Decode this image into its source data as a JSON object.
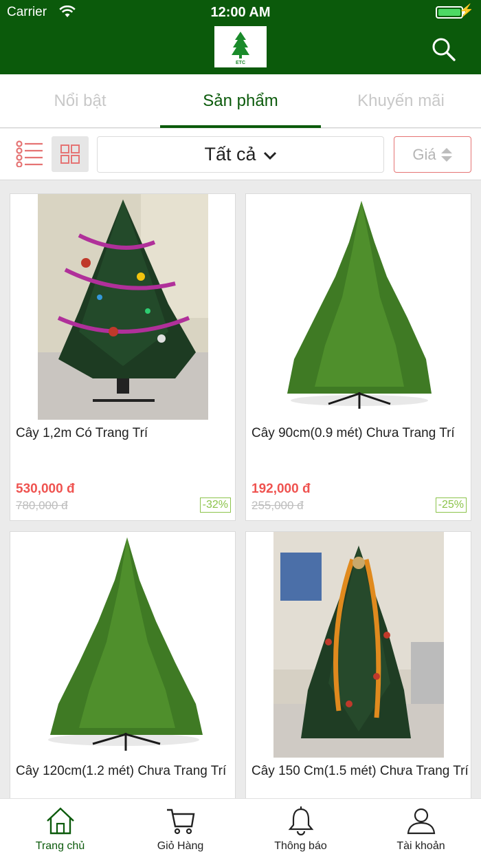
{
  "status_bar": {
    "carrier": "Carrier",
    "time": "12:00 AM"
  },
  "header": {
    "logo_text": "ETC",
    "search_icon": "search-icon"
  },
  "tabs": [
    {
      "label": "Nổi bật",
      "active": false
    },
    {
      "label": "Sản phẩm",
      "active": true
    },
    {
      "label": "Khuyến mãi",
      "active": false
    }
  ],
  "filter": {
    "view_list_icon": "list-view-icon",
    "view_grid_icon": "grid-view-icon",
    "view_mode": "grid",
    "category": "Tất cả",
    "sort_label": "Giá"
  },
  "products": [
    {
      "name": "Cây 1,2m Có Trang Trí",
      "price": "530,000 đ",
      "old_price": "780,000 đ",
      "discount": "-32%",
      "image": "decorated-christmas-tree"
    },
    {
      "name": "Cây 90cm(0.9 mét) Chưa Trang Trí",
      "price": "192,000 đ",
      "old_price": "255,000 đ",
      "discount": "-25%",
      "image": "plain-christmas-tree"
    },
    {
      "name": "Cây 120cm(1.2 mét) Chưa Trang Trí",
      "image": "plain-christmas-tree"
    },
    {
      "name": "Cây 150 Cm(1.5 mét) Chưa Trang Trí",
      "image": "decorated-christmas-tree-with-tinsel"
    }
  ],
  "bottom_nav": [
    {
      "label": "Trang chủ",
      "icon": "home-icon",
      "active": true
    },
    {
      "label": "Giỏ Hàng",
      "icon": "cart-icon",
      "active": false
    },
    {
      "label": "Thông báo",
      "icon": "bell-icon",
      "active": false
    },
    {
      "label": "Tài khoản",
      "icon": "user-icon",
      "active": false
    }
  ],
  "colors": {
    "brand": "#0b5a0b",
    "price": "#ef5350",
    "discount": "#8bc34a"
  }
}
